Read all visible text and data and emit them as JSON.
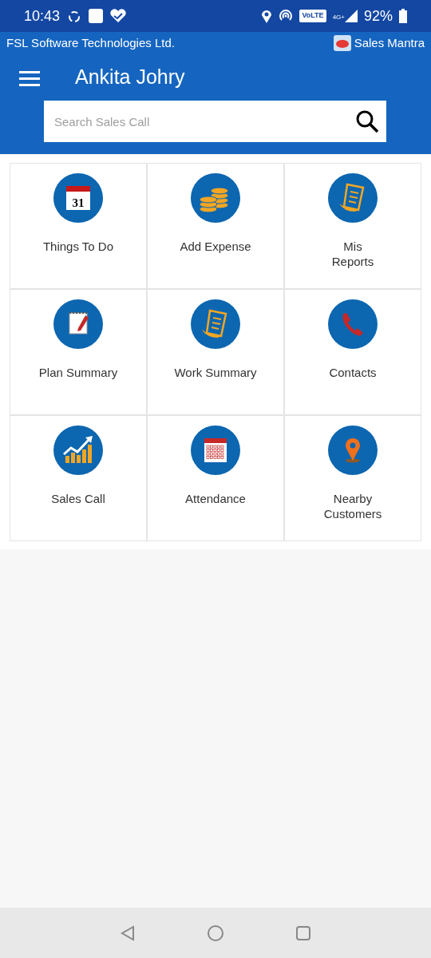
{
  "status_bar": {
    "time": "10:43",
    "volte": "VoLTE",
    "network": "4G+",
    "battery": "92%"
  },
  "header": {
    "company": "FSL Software Technologies Ltd.",
    "app_name": "Sales Mantra",
    "user_name": "Ankita Johry"
  },
  "search": {
    "placeholder": "Search Sales Call"
  },
  "tiles": [
    {
      "label": "Things To Do",
      "kind": "calendar",
      "date": "31"
    },
    {
      "label": "Add Expense",
      "kind": "coins"
    },
    {
      "label": "Mis\nReports",
      "kind": "report"
    },
    {
      "label": "Plan Summary",
      "kind": "notepad"
    },
    {
      "label": "Work Summary",
      "kind": "report"
    },
    {
      "label": "Contacts",
      "kind": "phone"
    },
    {
      "label": "Sales Call",
      "kind": "chart"
    },
    {
      "label": "Attendance",
      "kind": "schedule"
    },
    {
      "label": "Nearby\nCustomers",
      "kind": "pin"
    }
  ]
}
